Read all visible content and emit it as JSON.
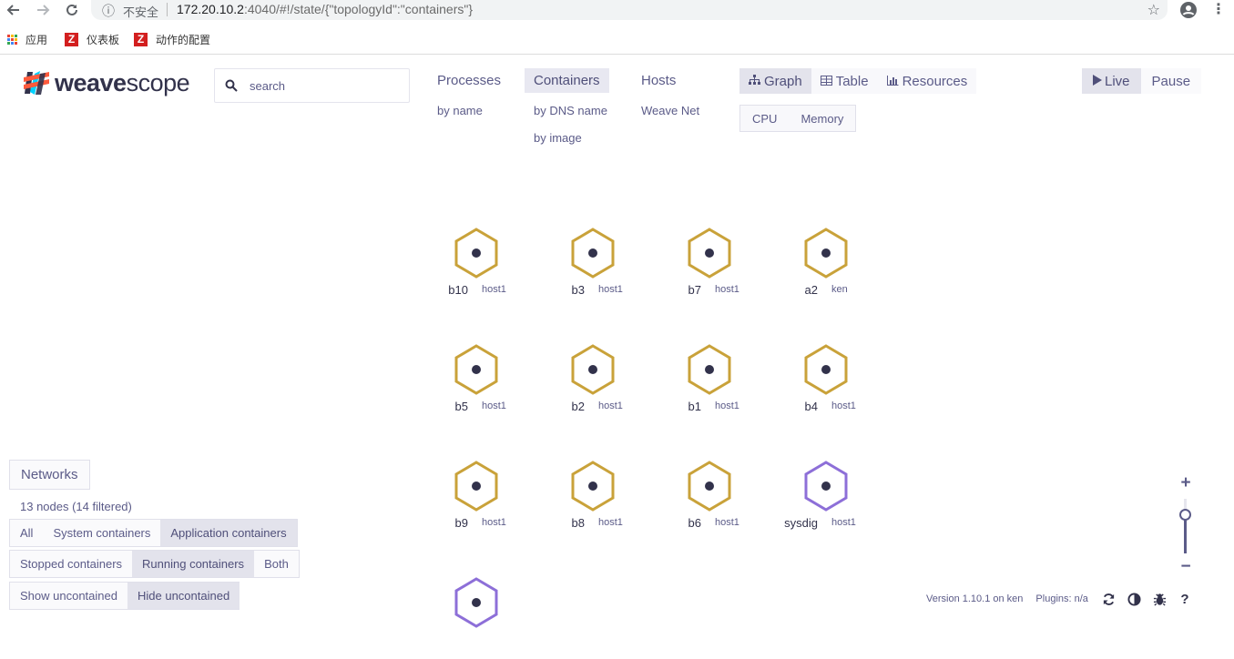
{
  "browser": {
    "security_label": "不安全",
    "url_host": "172.20.10.2",
    "url_rest": ":4040/#!/state/{\"topologyId\":\"containers\"}",
    "bookmarks": [
      {
        "label": "应用"
      },
      {
        "label": "仪表板"
      },
      {
        "label": "动作的配置"
      }
    ]
  },
  "app": {
    "logo_bold": "weave",
    "logo_light": "scope",
    "search_placeholder": "search"
  },
  "topologies": [
    {
      "label": "Processes",
      "sub": [
        "by name"
      ]
    },
    {
      "label": "Containers",
      "sub": [
        "by DNS name",
        "by image"
      ],
      "active": true
    },
    {
      "label": "Hosts",
      "sub": [
        "Weave Net"
      ]
    }
  ],
  "view_modes": [
    {
      "label": "Graph",
      "icon": "sitemap-icon",
      "active": true
    },
    {
      "label": "Table",
      "icon": "table-icon"
    },
    {
      "label": "Resources",
      "icon": "bar-chart-icon"
    }
  ],
  "metrics": [
    "CPU",
    "Memory"
  ],
  "playback": {
    "live": "Live",
    "pause": "Pause"
  },
  "nodes": [
    {
      "label": "b10",
      "sub": "host1",
      "color": "#c9a23a"
    },
    {
      "label": "b3",
      "sub": "host1",
      "color": "#c9a23a"
    },
    {
      "label": "b7",
      "sub": "host1",
      "color": "#c9a23a"
    },
    {
      "label": "a2",
      "sub": "ken",
      "color": "#c9a23a"
    },
    {
      "label": "b5",
      "sub": "host1",
      "color": "#c9a23a"
    },
    {
      "label": "b2",
      "sub": "host1",
      "color": "#c9a23a"
    },
    {
      "label": "b1",
      "sub": "host1",
      "color": "#c9a23a"
    },
    {
      "label": "b4",
      "sub": "host1",
      "color": "#c9a23a"
    },
    {
      "label": "b9",
      "sub": "host1",
      "color": "#c9a23a"
    },
    {
      "label": "b8",
      "sub": "host1",
      "color": "#c9a23a"
    },
    {
      "label": "b6",
      "sub": "host1",
      "color": "#c9a23a"
    },
    {
      "label": "sysdig",
      "sub": "host1",
      "color": "#8d6fd8"
    },
    {
      "label": "",
      "sub": "",
      "color": "#8d6fd8"
    }
  ],
  "controls": {
    "networks": "Networks",
    "status": "13 nodes (14 filtered)",
    "container_filter": [
      {
        "label": "All"
      },
      {
        "label": "System containers"
      },
      {
        "label": "Application containers",
        "active": true
      }
    ],
    "state_filter": [
      {
        "label": "Stopped containers"
      },
      {
        "label": "Running containers",
        "active": true
      },
      {
        "label": "Both"
      }
    ],
    "uncontained_filter": [
      {
        "label": "Show uncontained"
      },
      {
        "label": "Hide uncontained",
        "active": true
      }
    ]
  },
  "zoom": {
    "plus": "+",
    "minus": "−",
    "level": 0.7
  },
  "footer": {
    "version": "Version 1.10.1 on ken",
    "plugins": "Plugins: n/a"
  }
}
